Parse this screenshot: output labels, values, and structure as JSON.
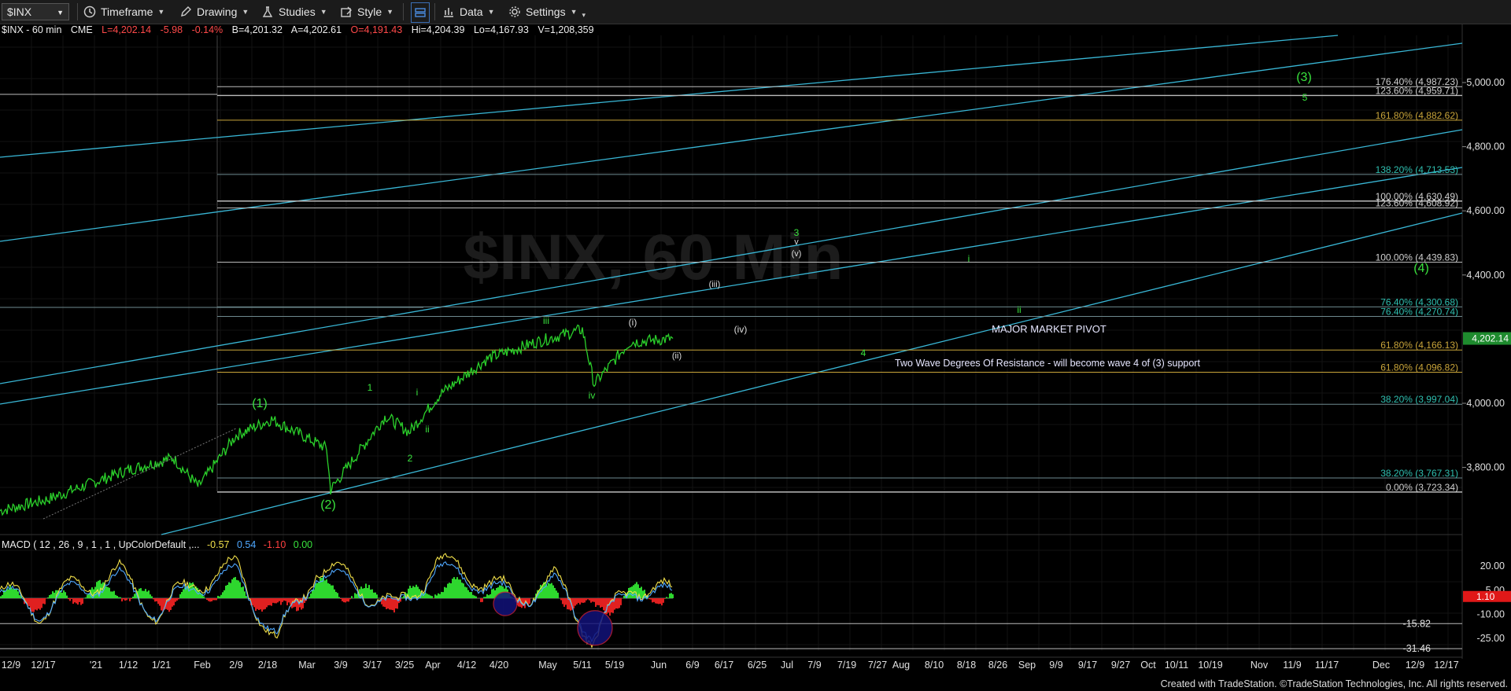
{
  "toolbar": {
    "symbol": "$INX",
    "timeframe": "Timeframe",
    "drawing": "Drawing",
    "studies": "Studies",
    "style": "Style",
    "data": "Data",
    "settings": "Settings"
  },
  "status": {
    "symbol": "$INX - 60 min",
    "exchange": "CME",
    "last": "L=4,202.14",
    "change": "-5.98",
    "change_pct": "-0.14%",
    "bid": "B=4,201.32",
    "ask": "A=4,202.61",
    "open": "O=4,191.43",
    "high": "Hi=4,204.39",
    "low": "Lo=4,167.93",
    "volume": "V=1,208,359"
  },
  "watermark": "$INX, 60 Min",
  "colors": {
    "price": "#2bd12b",
    "channel": "#39b7d6",
    "box_fill": "#05058a",
    "box_border": "#cc2b4a",
    "fib_line": "#9a9a9a",
    "fib_text": "#2fbfb0",
    "fib_gold": "#c9a53a",
    "label_green": "#39e23d",
    "macd_up": "#2ed72e",
    "macd_down": "#e02020"
  },
  "price_axis": {
    "ticks": [
      "5,000.00",
      "4,800.00",
      "4,600.00",
      "4,400.00",
      "4,000.00",
      "3,800.00"
    ],
    "last_tag": "4,202.14"
  },
  "macd_axis": {
    "ticks": [
      "20.00",
      "5.00",
      "-10.00",
      "-25.00"
    ],
    "extra": [
      "-15.82",
      "-31.46"
    ],
    "last_tag": "1.10"
  },
  "macd_legend": {
    "title": "MACD ( 12 , 26 , 9 , 1 , 1 , UpColorDefault ,...",
    "v1": "-0.57",
    "v2": "0.54",
    "v3": "-1.10",
    "v4": "0.00"
  },
  "time_axis": [
    "12/9",
    "12/17",
    "'21",
    "1/12",
    "1/21",
    "Feb",
    "2/9",
    "2/18",
    "Mar",
    "3/9",
    "3/17",
    "3/25",
    "Apr",
    "4/12",
    "4/20",
    "May",
    "5/11",
    "5/19",
    "Jun",
    "6/9",
    "6/17",
    "6/25",
    "Jul",
    "7/9",
    "7/19",
    "7/27",
    "Aug",
    "8/10",
    "8/18",
    "8/26",
    "Sep",
    "9/9",
    "9/17",
    "9/27",
    "Oct",
    "10/11",
    "10/19",
    "Nov",
    "11/9",
    "11/17",
    "Dec",
    "12/9",
    "12/17"
  ],
  "fib_labels": [
    {
      "text": "176.40% (4,987.23)"
    },
    {
      "text": "123.60% (4,959.71)"
    },
    {
      "text": "161.80% (4,882.62)"
    },
    {
      "text": "138.20% (4,713.53)"
    },
    {
      "text": "100.00% (4,630.49)"
    },
    {
      "text": "123.60% (4,608.92)"
    },
    {
      "text": "100.00% (4,439.83)"
    },
    {
      "text": "76.40% (4,300.68)"
    },
    {
      "text": "76.40% (4,270.74)"
    },
    {
      "text": "61.80% (4,166.13)"
    },
    {
      "text": "61.80% (4,096.82)"
    },
    {
      "text": "38.20% (3,997.04)"
    },
    {
      "text": "38.20% (3,767.31)"
    },
    {
      "text": "0.00% (3,723.34)"
    }
  ],
  "annotations": {
    "pivot": "MAJOR MARKET PIVOT",
    "resistance": "Two Wave Degrees Of Resistance - will become wave 4 of (3) support"
  },
  "wave_labels": [
    {
      "text": "(1)"
    },
    {
      "text": "(2)"
    },
    {
      "text": "(3)"
    },
    {
      "text": "(4)"
    },
    {
      "text": "1"
    },
    {
      "text": "2"
    },
    {
      "text": "3"
    },
    {
      "text": "4"
    },
    {
      "text": "5"
    },
    {
      "text": "i"
    },
    {
      "text": "ii"
    },
    {
      "text": "iii"
    },
    {
      "text": "iv"
    },
    {
      "text": "v"
    },
    {
      "text": "(i)"
    },
    {
      "text": "(ii)"
    },
    {
      "text": "(iii)"
    },
    {
      "text": "(iv)"
    },
    {
      "text": "(v)"
    }
  ],
  "footer": "Created with TradeStation. ©TradeStation Technologies, Inc. All rights reserved.",
  "chart_data": {
    "type": "line",
    "y_unit": "price",
    "ylim": [
      3650,
      5100
    ],
    "series": [
      {
        "x": [
          "12/9",
          "12/17",
          "1/12",
          "1/21",
          "Feb",
          "2/9",
          "2/18",
          "Mar",
          "3/9",
          "3/17",
          "3/25",
          "Apr",
          "4/12",
          "4/20",
          "May",
          "5/11",
          "5/19",
          "Jun"
        ],
        "values": [
          3665,
          3700,
          3790,
          3830,
          3740,
          3900,
          3950,
          3860,
          3730,
          3960,
          3910,
          4030,
          4140,
          4190,
          4230,
          4060,
          4190,
          4202
        ]
      }
    ],
    "macd": {
      "ylim": [
        -32,
        25
      ],
      "values": [
        5,
        -8,
        8,
        15,
        -10,
        12,
        18,
        -28,
        20,
        10,
        -8,
        22,
        15,
        0,
        12,
        -25,
        10,
        1
      ]
    }
  }
}
